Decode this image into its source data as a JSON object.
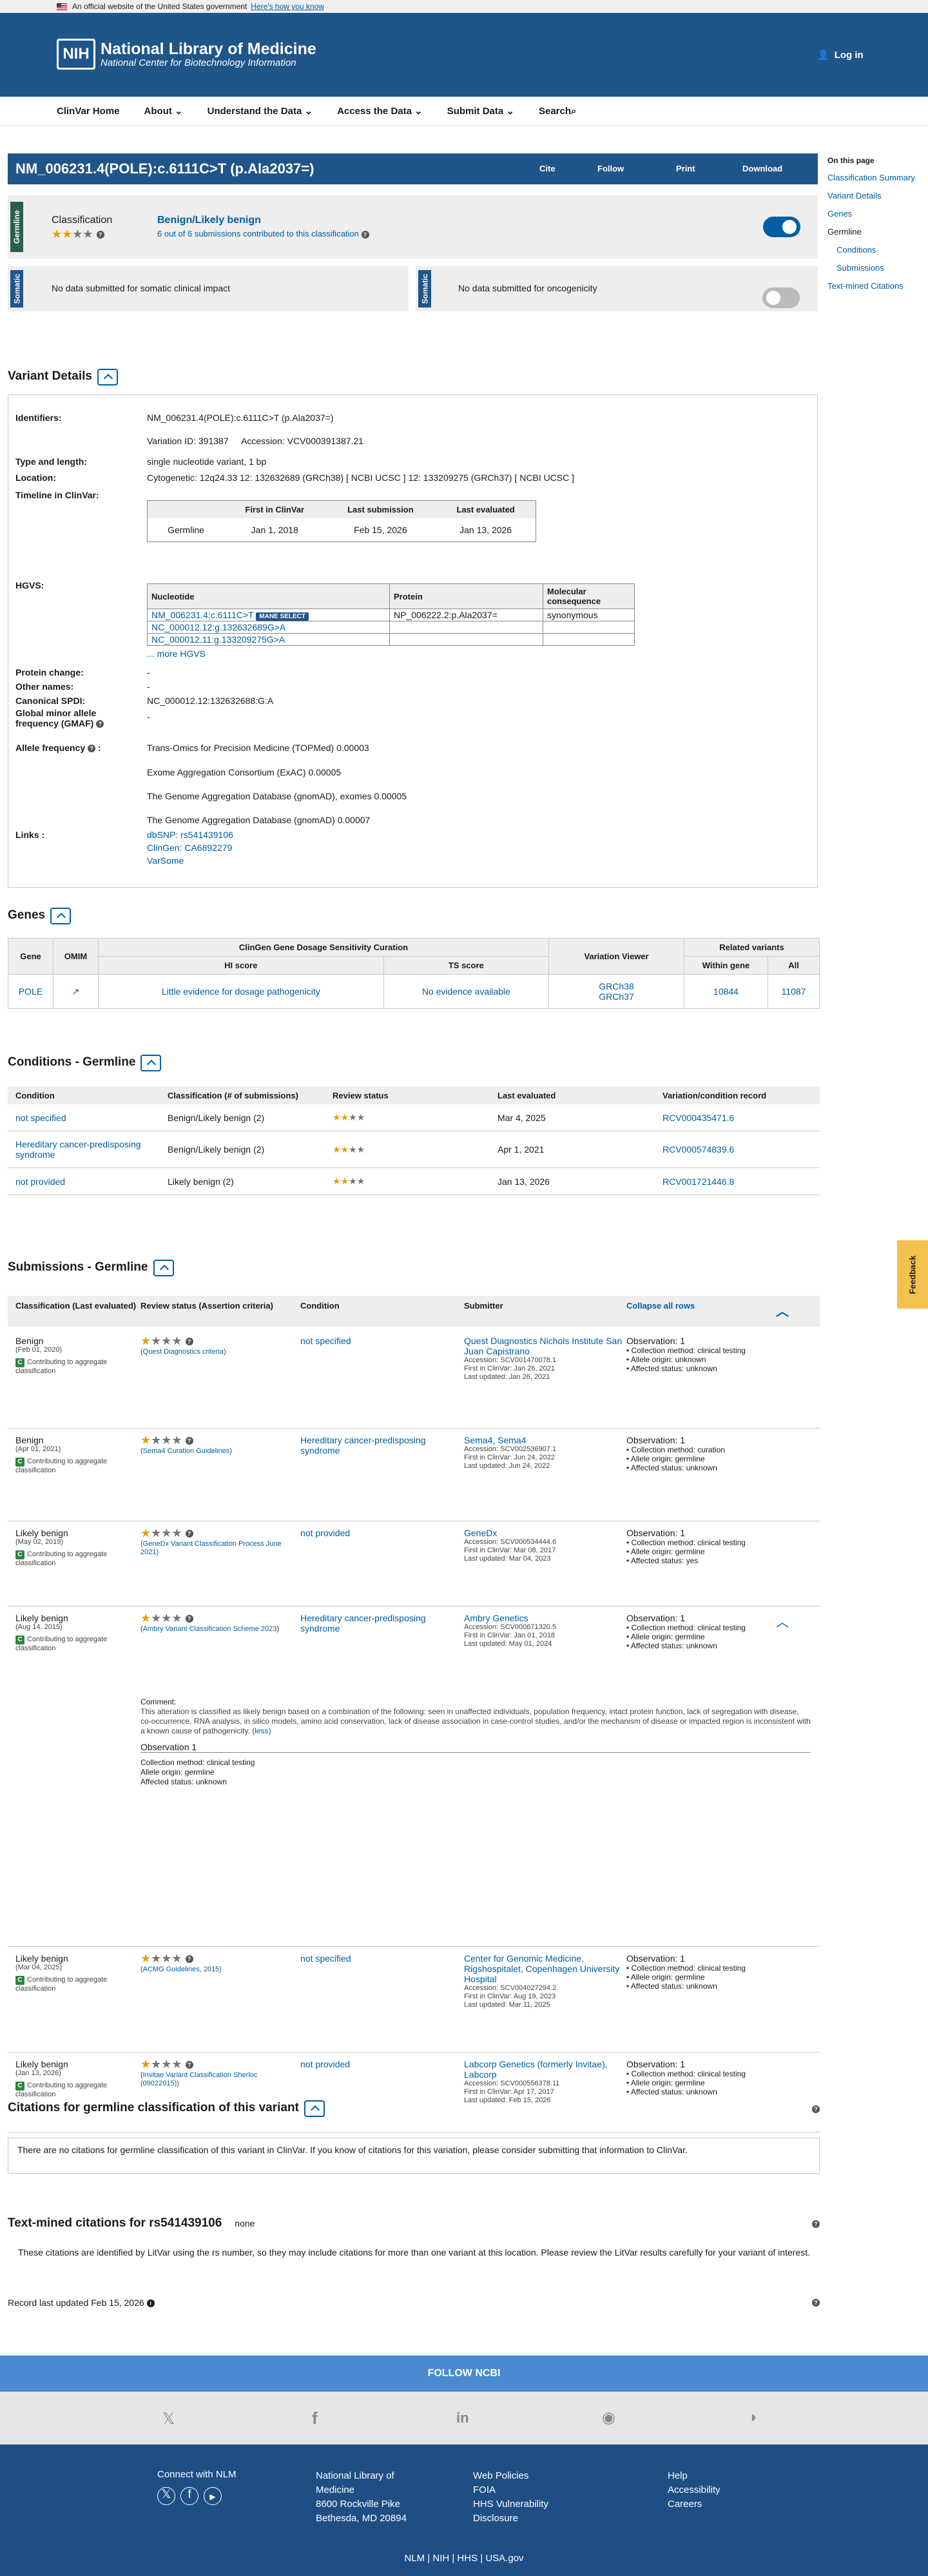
{
  "gov": {
    "text": "An official website of the United States government",
    "link": "Here's how you know"
  },
  "header": {
    "org": "National Library of Medicine",
    "sub": "National Center for Biotechnology Information",
    "logo": "NIH",
    "login": "Log in"
  },
  "nav": [
    "ClinVar Home",
    "About",
    "Understand the Data",
    "Access the Data",
    "Submit Data",
    "Search"
  ],
  "variant": {
    "title": "NM_006231.4(POLE):c.6111C>T (p.Ala2037=)",
    "actions": [
      "Cite",
      "Follow",
      "Print",
      "Download"
    ]
  },
  "onpage": {
    "heading": "On this page",
    "items": [
      "Classification Summary",
      "Variant Details",
      "Genes",
      "Germline",
      "Conditions",
      "Submissions",
      "Text-mined Citations"
    ]
  },
  "classification": {
    "label": "Germline",
    "title": "Classification",
    "value": "Benign/Likely benign",
    "subs": "6 out of 6 submissions contributed to this classification"
  },
  "somatic": {
    "label": "Somatic",
    "impact": "No data submitted for somatic clinical impact",
    "onco": "No data submitted for oncogenicity"
  },
  "details": {
    "heading": "Variant Details",
    "identifiers_label": "Identifiers:",
    "identifiers": "NM_006231.4(POLE):c.6111C>T (p.Ala2037=)",
    "variation_id": "Variation ID: 391387",
    "accession": "Accession: VCV000391387.21",
    "type_label": "Type and length:",
    "type": "single nucleotide variant, 1 bp",
    "location_label": "Location:",
    "location": "Cytogenetic: 12q24.33    12: 132632689 (GRCh38) [ NCBI  UCSC ]    12: 133209275 (GRCh37) [ NCBI  UCSC ]",
    "timeline_label": "Timeline in ClinVar:",
    "timeline_headers": [
      "First in ClinVar",
      "Last submission",
      "Last evaluated"
    ],
    "timeline_row": [
      "Germline",
      "Jan 1, 2018",
      "Feb 15, 2026",
      "Jan 13, 2026"
    ],
    "hgvs_label": "HGVS:",
    "hgvs_headers": [
      "Nucleotide",
      "Protein",
      "Molecular consequence"
    ],
    "hgvs_rows": [
      [
        "NM_006231.4:c.6111C>T",
        "NP_006222.2:p.Ala2037=",
        "synonymous"
      ],
      [
        "NC_000012.12:g.132632689G>A",
        "",
        ""
      ],
      [
        "NC_000012.11:g.133209275G>A",
        "",
        ""
      ]
    ],
    "mane": "MANE SELECT",
    "more_hgvs": "... more HGVS",
    "protein_label": "Protein change:",
    "protein": "-",
    "other_label": "Other names:",
    "other": "-",
    "spdi_label": "Canonical SPDI:",
    "spdi": "NC_000012.12:132632688:G:A",
    "gmaf_label": "Global minor allele frequency (GMAF)",
    "gmaf": "-",
    "af_label": "Allele frequency",
    "af": [
      "Trans-Omics for Precision Medicine (TOPMed) 0.00003",
      "Exome Aggregation Consortium (ExAC) 0.00005",
      "The Genome Aggregation Database (gnomAD), exomes 0.00005",
      "The Genome Aggregation Database (gnomAD) 0.00007"
    ],
    "links_label": "Links :",
    "links": [
      "dbSNP: rs541439106",
      "ClinGen: CA6892279",
      "VarSome"
    ]
  },
  "genes": {
    "heading": "Genes",
    "h_gene": "Gene",
    "h_omim": "OMIM",
    "h_clingen": "ClinGen Gene Dosage Sensitivity Curation",
    "h_hi": "HI score",
    "h_ts": "TS score",
    "h_viewer": "Variation Viewer",
    "h_related": "Related variants",
    "h_within": "Within gene",
    "h_all": "All",
    "row": {
      "gene": "POLE",
      "hi": "Little evidence for dosage pathogenicity",
      "ts": "No evidence available",
      "v1": "GRCh38",
      "v2": "GRCh37",
      "within": "10844",
      "all": "11087"
    }
  },
  "conditions": {
    "heading": "Conditions - Germline",
    "headers": [
      "Condition",
      "Classification (# of submissions)",
      "Review status",
      "Last evaluated",
      "Variation/condition record"
    ],
    "rows": [
      [
        "not specified",
        "Benign/Likely benign (2)",
        "Mar 4, 2025",
        "RCV000435471.6"
      ],
      [
        "Hereditary cancer-predisposing syndrome",
        "Benign/Likely benign (2)",
        "Apr 1, 2021",
        "RCV000574839.6"
      ],
      [
        "not provided",
        "Likely benign (2)",
        "Jan 13, 2026",
        "RCV001721446.8"
      ]
    ]
  },
  "subs": {
    "heading": "Submissions - Germline",
    "h1": "Classification (Last evaluated)",
    "h2": "Review status (Assertion criteria)",
    "h3": "Condition",
    "h4": "Submitter",
    "collapse": "Collapse all rows",
    "contrib": "Contributing to aggregate classification",
    "rows": [
      {
        "cls": "Benign",
        "date": "(Feb 01, 2020)",
        "crit": "Quest Diagnostics criteria",
        "cond": "not specified",
        "sub": "Quest Diagnostics Nichols Institute San Juan Capistrano",
        "meta": [
          "Accession: SCV001470078.1",
          "First in ClinVar: Jan 26, 2021",
          "Last updated: Jan 26, 2021"
        ],
        "obs": [
          "Observation: 1",
          "• Collection method: clinical testing",
          "• Allele origin: unknown",
          "• Affected status: unknown"
        ]
      },
      {
        "cls": "Benign",
        "date": "(Apr 01, 2021)",
        "crit": "Sema4 Curation Guidelines",
        "cond": "Hereditary cancer-predisposing syndrome",
        "sub": "Sema4, Sema4",
        "meta": [
          "Accession: SCV002536907.1",
          "First in ClinVar: Jun 24, 2022",
          "Last updated: Jun 24, 2022"
        ],
        "obs": [
          "Observation: 1",
          "• Collection method: curation",
          "• Allele origin: germline",
          "• Affected status: unknown"
        ]
      },
      {
        "cls": "Likely benign",
        "date": "(May 02, 2019)",
        "crit": "GeneDx Variant Classification Process June 2021",
        "cond": "not provided",
        "sub": "GeneDx",
        "meta": [
          "Accession: SCV000534444.6",
          "First in ClinVar: Mar 08, 2017",
          "Last updated: Mar 04, 2023"
        ],
        "obs": [
          "Observation: 1",
          "• Collection method: clinical testing",
          "• Allele origin: germline",
          "• Affected status: yes"
        ]
      },
      {
        "cls": "Likely benign",
        "date": "(Aug 14, 2015)",
        "crit": "Ambry Variant Classification Scheme 2023",
        "cond": "Hereditary cancer-predisposing syndrome",
        "sub": "Ambry Genetics",
        "meta": [
          "Accession: SCV000671320.5",
          "First in ClinVar: Jan 01, 2018",
          "Last updated: May 01, 2024"
        ],
        "obs": [
          "Observation: 1",
          "• Collection method: clinical testing",
          "• Allele origin: germline",
          "• Affected status: unknown"
        ]
      },
      {
        "cls": "Likely benign",
        "date": "(Mar 04, 2025)",
        "crit": "ACMG Guidelines, 2015",
        "cond": "not specified",
        "sub": "Center for Genomic Medicine, Rigshospitalet, Copenhagen University Hospital",
        "meta": [
          "Accession: SCV004027294.2",
          "First in ClinVar: Aug 19, 2023",
          "Last updated: Mar 11, 2025"
        ],
        "obs": [
          "Observation: 1",
          "• Collection method: clinical testing",
          "• Allele origin: germline",
          "• Affected status: unknown"
        ]
      },
      {
        "cls": "Likely benign",
        "date": "(Jan 13, 2026)",
        "crit": "Invitae Variant Classification Sherloc (09022015)",
        "cond": "not provided",
        "sub": "Labcorp Genetics (formerly Invitae), Labcorp",
        "meta": [
          "Accession: SCV000556378.11",
          "First in ClinVar: Apr 17, 2017",
          "Last updated: Feb 15, 2026"
        ],
        "obs": [
          "Observation: 1",
          "• Collection method: clinical testing",
          "• Allele origin: germline",
          "• Affected status: unknown"
        ]
      }
    ],
    "comment_label": "Comment:",
    "comment": "This alteration is classified as likely benign based on a combination of the following: seen in unaffected individuals, population frequency, intact protein function, lack of segregation with disease, co-occurrence, RNA analysis, in silico models, amino acid conservation, lack of disease association in case-control studies, and/or the mechanism of disease or impacted region is inconsistent with a known cause of pathogenicity.",
    "less": "(less)",
    "obs_head": "Observation 1",
    "obs_detail": [
      "Collection method: clinical testing",
      "Allele origin: germline",
      "Affected status: unknown"
    ]
  },
  "citations": {
    "heading": "Citations for germline classification of this variant",
    "text": "There are no citations for germline classification of this variant in ClinVar. If you know of citations for this variation, please consider submitting that information to ClinVar."
  },
  "textmined": {
    "heading": "Text-mined citations for rs541439106",
    "none": "none",
    "text": "These citations are identified by LitVar using the rs number, so they may include citations for more than one variant at this location. Please review the LitVar results carefully for your variant of interest."
  },
  "record": "Record last updated Feb 15, 2026",
  "feedback": "Feedback",
  "footer": {
    "follow": "FOLLOW NCBI",
    "connect": "Connect with NLM",
    "addr": [
      "National Library of",
      "Medicine",
      "8600 Rockville Pike",
      "Bethesda, MD 20894"
    ],
    "col3": [
      "Web Policies",
      "FOIA",
      "HHS Vulnerability",
      "Disclosure"
    ],
    "col4": [
      "Help",
      "Accessibility",
      "Careers"
    ],
    "bottom": "NLM | NIH | HHS | USA.gov"
  }
}
